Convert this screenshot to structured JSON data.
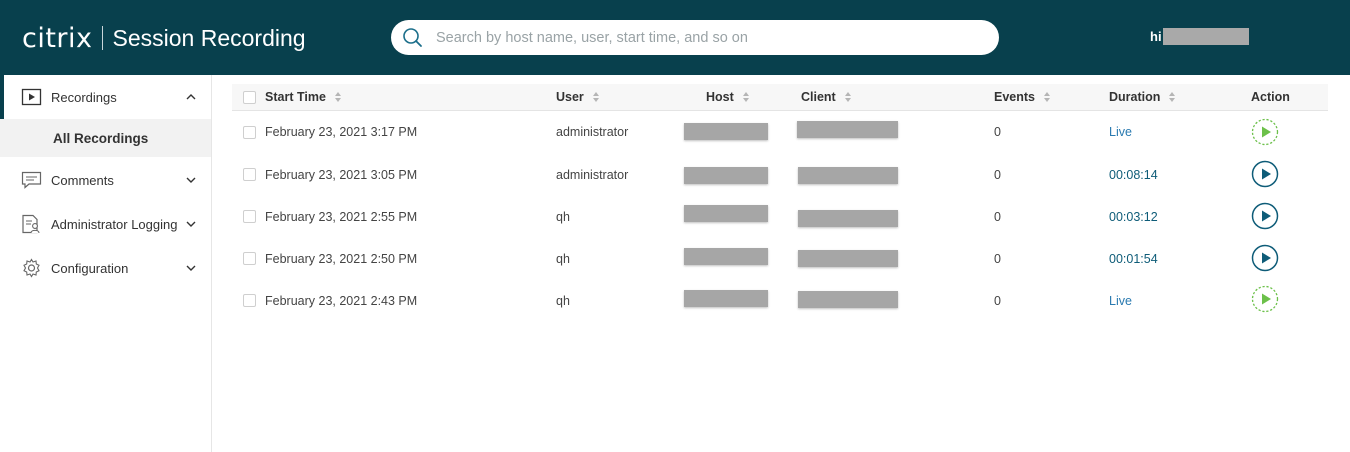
{
  "header": {
    "logo": "citrix",
    "product": "Session Recording",
    "search_placeholder": "Search by host name, user, start time, and so on",
    "user_greeting": "hi"
  },
  "sidebar": {
    "items": [
      {
        "label": "Recordings",
        "icon": "play-box-icon",
        "expanded": true
      },
      {
        "label": "Comments",
        "icon": "comment-icon"
      },
      {
        "label": "Administrator Logging",
        "icon": "admin-log-icon"
      },
      {
        "label": "Configuration",
        "icon": "gear-icon"
      }
    ],
    "sub_item": "All Recordings"
  },
  "table": {
    "columns": {
      "start_time": "Start Time",
      "user": "User",
      "host": "Host",
      "client": "Client",
      "events": "Events",
      "duration": "Duration",
      "action": "Action"
    },
    "rows": [
      {
        "start_time": "February 23, 2021 3:17 PM",
        "user": "administrator",
        "events": "0",
        "duration": "Live",
        "live": true
      },
      {
        "start_time": "February 23, 2021 3:05 PM",
        "user": "administrator",
        "events": "0",
        "duration": "00:08:14",
        "live": false
      },
      {
        "start_time": "February 23, 2021 2:55 PM",
        "user": "qh",
        "events": "0",
        "duration": "00:03:12",
        "live": false
      },
      {
        "start_time": "February 23, 2021 2:50 PM",
        "user": "qh",
        "events": "0",
        "duration": "00:01:54",
        "live": false
      },
      {
        "start_time": "February 23, 2021 2:43 PM",
        "user": "qh",
        "events": "0",
        "duration": "Live",
        "live": true
      }
    ]
  },
  "colors": {
    "header_bg": "#08404d",
    "play_completed": "#0e5c78",
    "play_live": "#6cc04a",
    "redacted": "#a6a6a6"
  }
}
